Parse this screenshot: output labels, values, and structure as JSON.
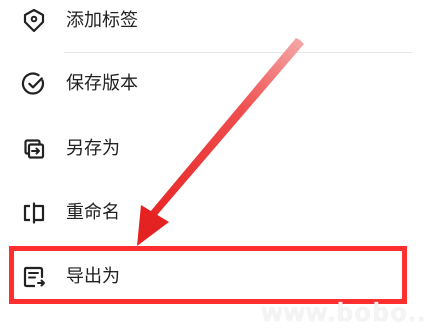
{
  "menu": {
    "items": [
      {
        "label": "添加标签",
        "icon": "tag-icon"
      },
      {
        "label": "保存版本",
        "icon": "check-circle-icon"
      },
      {
        "label": "另存为",
        "icon": "save-as-icon"
      },
      {
        "label": "重命名",
        "icon": "rename-icon"
      },
      {
        "label": "导出为",
        "icon": "export-document-icon"
      }
    ]
  },
  "annotation": {
    "color": "#ff2f2f"
  },
  "watermark": {
    "text": "www.bobo...com"
  }
}
